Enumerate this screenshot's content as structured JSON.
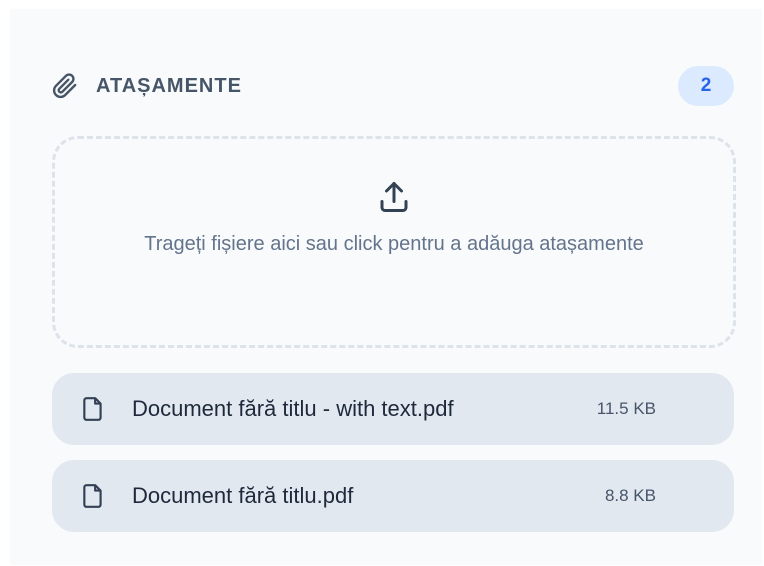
{
  "attachments": {
    "title": "ATAȘAMENTE",
    "count": "2",
    "dropzone_hint": "Trageți fișiere aici sau click pentru a adăuga atașamente",
    "icons": {
      "header": "paperclip-icon",
      "dropzone": "upload-icon",
      "file": "file-icon"
    },
    "files": [
      {
        "name": "Document fără titlu - with text.pdf",
        "size": "11.5 KB"
      },
      {
        "name": "Document fără titlu.pdf",
        "size": "8.8 KB"
      }
    ]
  },
  "colors": {
    "panel_bg": "#f8fafc",
    "title": "#475569",
    "badge_bg": "#dbeafe",
    "badge_text": "#2563eb",
    "file_bg": "#e2e8f0",
    "dashed_border": "#dde3ea"
  }
}
